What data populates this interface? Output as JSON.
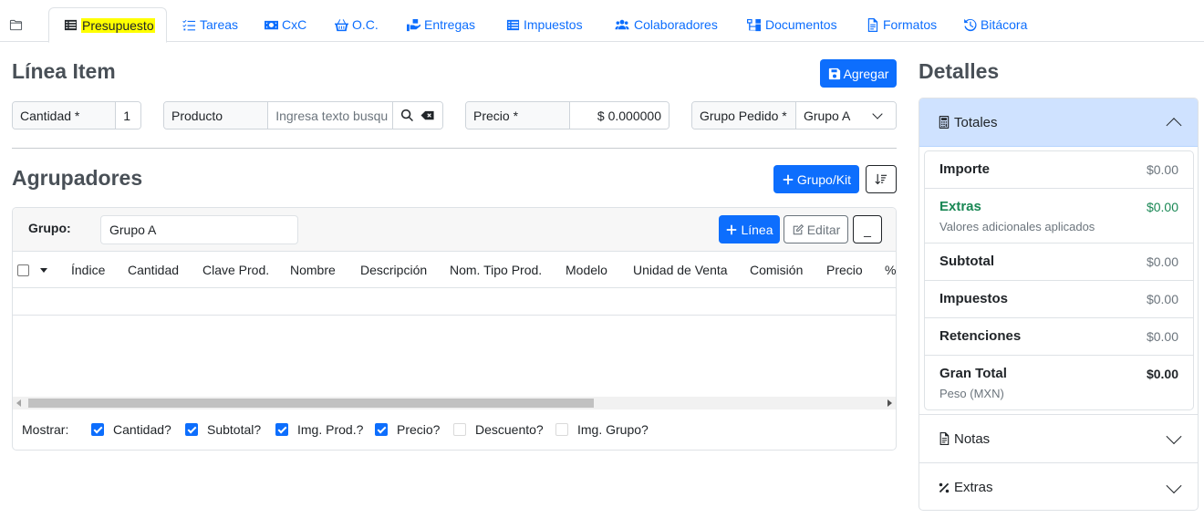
{
  "tabs": [
    {
      "id": "folder",
      "label": ""
    },
    {
      "id": "presupuesto",
      "label": "Presupuesto"
    },
    {
      "id": "tareas",
      "label": "Tareas"
    },
    {
      "id": "cxc",
      "label": "CxC"
    },
    {
      "id": "oc",
      "label": "O.C."
    },
    {
      "id": "entregas",
      "label": "Entregas"
    },
    {
      "id": "impuestos",
      "label": "Impuestos"
    },
    {
      "id": "colaboradores",
      "label": "Colaboradores"
    },
    {
      "id": "documentos",
      "label": "Documentos"
    },
    {
      "id": "formatos",
      "label": "Formatos"
    },
    {
      "id": "bitacora",
      "label": "Bitácora"
    }
  ],
  "linea_item": {
    "title": "Línea Item",
    "add_button": "Agregar",
    "cantidad_label": "Cantidad *",
    "cantidad_value": "1",
    "producto_label": "Producto",
    "producto_placeholder": "Ingresa texto busqu",
    "precio_label": "Precio *",
    "precio_value": "$ 0.000000",
    "grupo_pedido_label": "Grupo Pedido *",
    "grupo_pedido_value": "Grupo A"
  },
  "agrupadores": {
    "title": "Agrupadores",
    "grupo_kit_button": "Grupo/Kit",
    "grupo_label": "Grupo:",
    "grupo_value": "Grupo A",
    "linea_button": "Línea",
    "editar_button": "Editar",
    "minimize_button": "_",
    "columns": [
      "Índice",
      "Cantidad",
      "Clave Prod.",
      "Nombre",
      "Descripción",
      "Nom. Tipo Prod.",
      "Modelo",
      "Unidad de Venta",
      "Comisión",
      "Precio",
      "%"
    ],
    "mostrar_label": "Mostrar:",
    "mostrar": [
      {
        "label": "Cantidad?",
        "checked": true
      },
      {
        "label": "Subtotal?",
        "checked": true
      },
      {
        "label": "Img. Prod.?",
        "checked": true
      },
      {
        "label": "Precio?",
        "checked": true
      },
      {
        "label": "Descuento?",
        "checked": false
      },
      {
        "label": "Img. Grupo?",
        "checked": false
      }
    ]
  },
  "detalles": {
    "title": "Detalles",
    "totales_label": "Totales",
    "rows": {
      "importe": {
        "label": "Importe",
        "value": "$0.00"
      },
      "extras": {
        "label": "Extras",
        "value": "$0.00",
        "sub": "Valores adicionales aplicados"
      },
      "subtotal": {
        "label": "Subtotal",
        "value": "$0.00"
      },
      "impuestos": {
        "label": "Impuestos",
        "value": "$0.00"
      },
      "retenciones": {
        "label": "Retenciones",
        "value": "$0.00"
      },
      "gran_total": {
        "label": "Gran Total",
        "value": "$0.00",
        "sub": "Peso (MXN)"
      }
    },
    "notas_label": "Notas",
    "extras_label": "Extras"
  },
  "colors": {
    "primary": "#0d6efd",
    "highlight": "#ffff00",
    "extras_green": "#198754",
    "accordion_active": "#cfe2ff"
  }
}
